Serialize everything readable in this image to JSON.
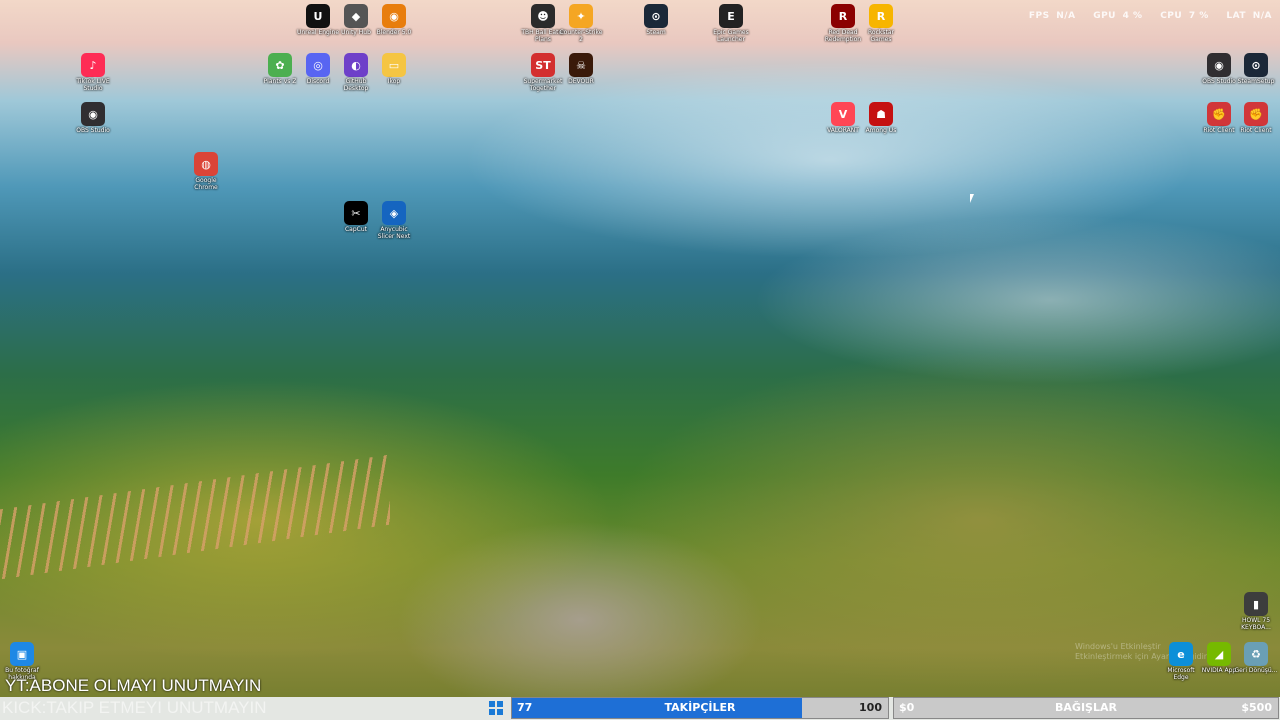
{
  "overlay": {
    "fps_label": "FPS",
    "fps_value": "N/A",
    "gpu_label": "GPU",
    "gpu_value": "4 %",
    "cpu_label": "CPU",
    "cpu_value": "7 %",
    "lat_label": "LAT",
    "lat_value": "N/A"
  },
  "desktop_icons": [
    {
      "id": "unreal",
      "label": "Unreal Engine",
      "glyph": "U",
      "color": "#111111"
    },
    {
      "id": "unity",
      "label": "Unity Hub",
      "glyph": "◆",
      "color": "#555555"
    },
    {
      "id": "blender",
      "label": "Blender 5.0",
      "glyph": "◉",
      "color": "#e87d0d"
    },
    {
      "id": "tbh",
      "label": "TBH Ball Eater Plans",
      "glyph": "☻",
      "color": "#2b2b2b"
    },
    {
      "id": "counter",
      "label": "Counter-Strike 2",
      "glyph": "✦",
      "color": "#f5a623"
    },
    {
      "id": "steam",
      "label": "Steam",
      "glyph": "⊙",
      "color": "#1b2838"
    },
    {
      "id": "epic",
      "label": "Epic Games Launcher",
      "glyph": "E",
      "color": "#222222"
    },
    {
      "id": "rdr",
      "label": "Red Dead Redemption",
      "glyph": "R",
      "color": "#8b0000"
    },
    {
      "id": "rockstar",
      "label": "Rockstar Games",
      "glyph": "R",
      "color": "#f7b500"
    },
    {
      "id": "tiktok",
      "label": "TikTok LIVE Studio",
      "glyph": "♪",
      "color": "#fe2c55"
    },
    {
      "id": "plants",
      "label": "Plants vs Z",
      "glyph": "✿",
      "color": "#4caf50"
    },
    {
      "id": "discord",
      "label": "Discord",
      "glyph": "◎",
      "color": "#5865f2"
    },
    {
      "id": "github",
      "label": "GitHub Desktop",
      "glyph": "◐",
      "color": "#6e40c9"
    },
    {
      "id": "folder",
      "label": "Ikop",
      "glyph": "▭",
      "color": "#f5c542"
    },
    {
      "id": "supermarket",
      "label": "Supermarket Together",
      "glyph": "ST",
      "color": "#d32f2f"
    },
    {
      "id": "devour",
      "label": "DEVOUR",
      "glyph": "☠",
      "color": "#3a1a0a"
    },
    {
      "id": "obs2",
      "label": "OBS Studio",
      "glyph": "◉",
      "color": "#302e31"
    },
    {
      "id": "steamsetup",
      "label": "SteamSetup",
      "glyph": "⊙",
      "color": "#1b2838"
    },
    {
      "id": "obs1",
      "label": "OBS Studio",
      "glyph": "◉",
      "color": "#302e31"
    },
    {
      "id": "valorant",
      "label": "VALORANT",
      "glyph": "V",
      "color": "#ff4655"
    },
    {
      "id": "amongus",
      "label": "Among Us",
      "glyph": "☗",
      "color": "#c51111"
    },
    {
      "id": "riot1",
      "label": "Riot Client",
      "glyph": "✊",
      "color": "#d13639"
    },
    {
      "id": "riot2",
      "label": "Riot Client",
      "glyph": "✊",
      "color": "#d13639"
    },
    {
      "id": "chrome",
      "label": "Google Chrome",
      "glyph": "◍",
      "color": "#db4437"
    },
    {
      "id": "capcut",
      "label": "CapCut",
      "glyph": "✂",
      "color": "#000000"
    },
    {
      "id": "anycubic",
      "label": "Anycubic Slicer Next",
      "glyph": "◈",
      "color": "#1565c0"
    },
    {
      "id": "howl",
      "label": "HOWL 75 KEYBOA...",
      "glyph": "▮",
      "color": "#3d3d3d"
    },
    {
      "id": "photos",
      "label": "Bu fotoğraf hakkında",
      "glyph": "▣",
      "color": "#1e88e5"
    },
    {
      "id": "edge",
      "label": "Microsoft Edge",
      "glyph": "e",
      "color": "#0c8fd8"
    },
    {
      "id": "nvidia",
      "label": "NVIDIA App",
      "glyph": "◢",
      "color": "#76b900"
    },
    {
      "id": "recycle",
      "label": "Geri Dönüşü...",
      "glyph": "♻",
      "color": "#6a9fb5"
    }
  ],
  "activate_notice": {
    "line1": "Windows'u Etkinleştir",
    "line2": "Etkinleştirmek için Ayarlar'a gidin."
  },
  "stream_banner": {
    "line1": "YT:ABONE OLMAYI UNUTMAYIN",
    "line2": "KICK:TAKIP ETMEYI UNUTMAYIN"
  },
  "followers_bar": {
    "current": "77",
    "label": "TAKİPÇİLER",
    "goal": "100",
    "fill_percent": 77,
    "fill_color": "#1e6fd6"
  },
  "donations_bar": {
    "current": "$0",
    "label": "BAĞIŞLAR",
    "goal": "$500",
    "fill_percent": 0
  }
}
